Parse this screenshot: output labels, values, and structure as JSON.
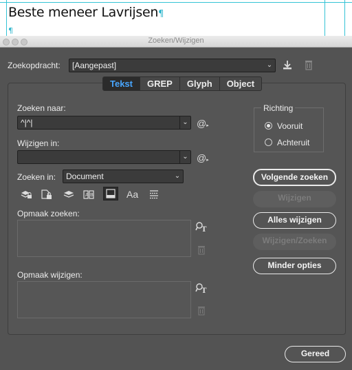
{
  "document": {
    "text": "Beste meneer Lavrijsen",
    "pilcrow": "¶"
  },
  "window": {
    "title": "Zoeken/Wijzigen"
  },
  "query": {
    "label": "Zoekopdracht:",
    "value": "[Aangepast]"
  },
  "tabs": [
    "Tekst",
    "GREP",
    "Glyph",
    "Object"
  ],
  "find": {
    "label": "Zoeken naar:",
    "value": "^|^|"
  },
  "change": {
    "label": "Wijzigen in:",
    "value": ""
  },
  "search_in": {
    "label": "Zoeken in:",
    "value": "Document"
  },
  "format_find": {
    "label": "Opmaak zoeken:"
  },
  "format_change": {
    "label": "Opmaak wijzigen:"
  },
  "direction": {
    "label": "Richting",
    "options": [
      "Vooruit",
      "Achteruit"
    ],
    "selected": "Vooruit"
  },
  "buttons": {
    "find_next": "Volgende zoeken",
    "change": "Wijzigen",
    "change_all": "Alles wijzigen",
    "change_find": "Wijzigen/Zoeken",
    "fewer_options": "Minder opties",
    "done": "Gereed"
  },
  "icons": {
    "special_char": "@",
    "dropdown": "⌄"
  }
}
